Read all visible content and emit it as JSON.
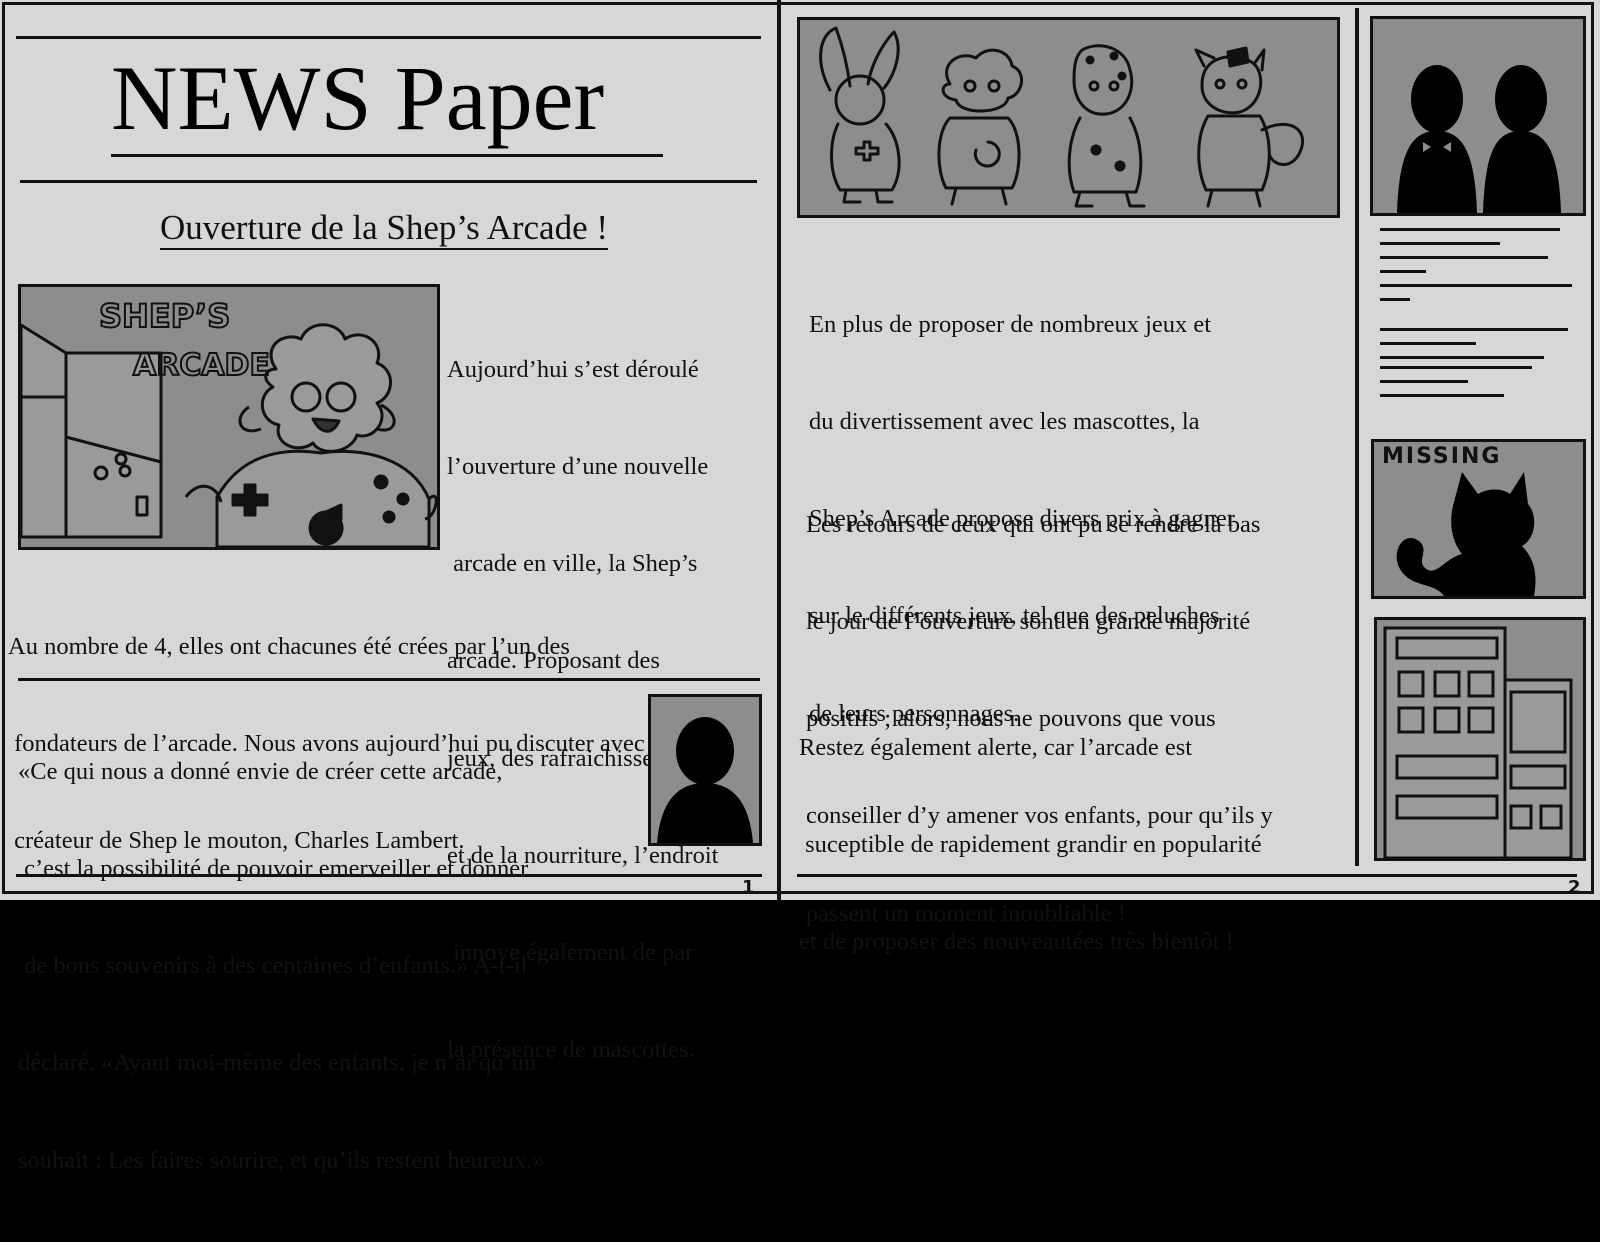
{
  "masthead": {
    "title": "NEWS Paper"
  },
  "article": {
    "headline": "Ouverture de la Shep’s Arcade !",
    "lead_lines": [
      "Aujourd’hui s’est déroulé",
      "l’ouverture d’une nouvelle",
      " arcade en ville, la Shep’s",
      "arcade. Proposant des",
      "jeux, des rafraichissements",
      "et de la nourriture, l’endroit",
      " innove également de par",
      "la présence de mascottes."
    ],
    "body_lines": [
      "Au nombre de 4, elles ont chacunes été crées par l’un des",
      " fondateurs de l’arcade. Nous avons aujourd’hui pu discuter avec le",
      " créateur de Shep le mouton, Charles Lambert."
    ],
    "quote_lines": [
      "«Ce qui nous a donné envie de créer cette arcade,",
      " c’est la possibilité de pouvoir emerveiller et donner",
      " de bons souvenirs à des centaines d’enfants.» A-t-il",
      "déclaré. «Ayant moi-même des enfants, je n’ai qu’un",
      "souhait : Les faires sourire, et qu’ils restent heureux.»"
    ],
    "illustration_sign": "SHEP’S ARCADE"
  },
  "page2": {
    "para1_lines": [
      "En plus de proposer de nombreux jeux et",
      "du divertissement avec les mascottes, la",
      "Shep’s Arcade propose divers prix à gagner",
      "sur le différents jeux, tel que des peluches",
      "de leurs personnages."
    ],
    "para2_lines": [
      "Les retours de ceux qui ont pu se rendre là bas",
      "le jour de l’ouverture sont en grande majorité",
      "positifs ; alors, nous ne pouvons que vous",
      "conseiller d’y amener vos enfants, pour qu’ils y",
      "passent un moment inoubliable !"
    ],
    "para3_lines": [
      "Restez également alerte, car l’arcade est",
      " suceptible de rapidement grandir en popularité",
      "et de proposer des nouveautées très bientôt !"
    ],
    "missing_label": "MISSING"
  },
  "page_numbers": {
    "left": "1",
    "right": "2"
  },
  "colors": {
    "paper": "#d7d7d9",
    "panel": "#8d8d8f",
    "ink": "#111111"
  }
}
